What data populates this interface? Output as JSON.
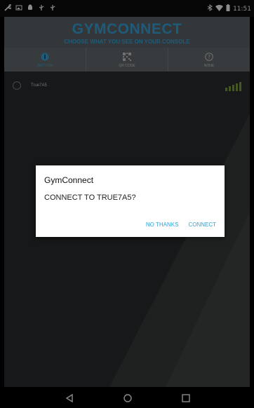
{
  "status_bar": {
    "time": "11:51",
    "left_icons": [
      "wrench-icon",
      "image-icon",
      "android-icon",
      "usb-icon",
      "usb-icon"
    ],
    "right_icons": [
      "bluetooth-icon",
      "wifi-icon",
      "battery-icon"
    ]
  },
  "app": {
    "title": "GYMCONNECT",
    "subtitle": "CHOOSE WHAT YOU SEE ON YOUR CONSOLE",
    "tabs": [
      {
        "label": "BUTTON",
        "icon": "button-icon",
        "active": true
      },
      {
        "label": "QR CODE",
        "icon": "qr-code-icon",
        "active": false
      },
      {
        "label": "NONE",
        "icon": "help-icon",
        "active": false
      }
    ],
    "devices": [
      {
        "name": "True7A5",
        "signal_bars": 5
      }
    ]
  },
  "dialog": {
    "title": "GymConnect",
    "message": "CONNECT TO TRUE7A5?",
    "actions": {
      "cancel": "NO THANKS",
      "confirm": "CONNECT"
    }
  },
  "colors": {
    "accent": "#37a7de",
    "signal": "#7aa13a",
    "list_background": "#2b2d2e",
    "header_background": "#5e6568"
  },
  "nav_bar": [
    "back-icon",
    "home-icon",
    "recents-icon"
  ]
}
